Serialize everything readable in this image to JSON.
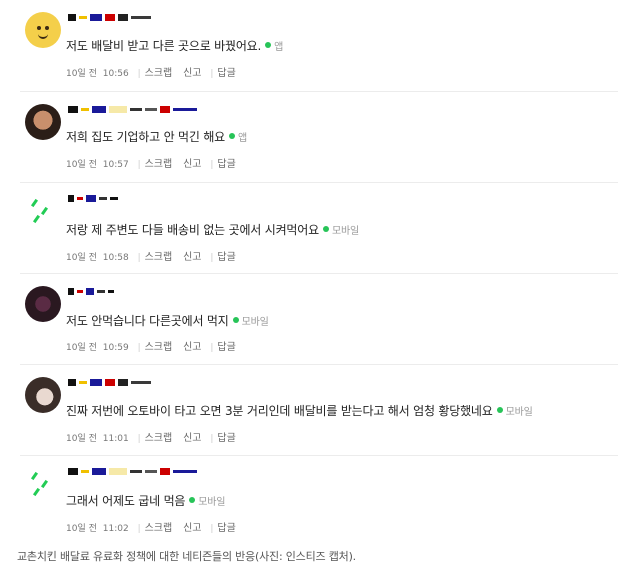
{
  "comments": [
    {
      "text": "저도 배달비 받고 다른 곳으로 바꿨어요.",
      "device": "앱",
      "date": "10일 전",
      "time": "10:56"
    },
    {
      "text": "저희 집도 기업하고 안 먹긴 해요",
      "device": "앱",
      "date": "10일 전",
      "time": "10:57"
    },
    {
      "text": "저랑 제 주변도 다들 배송비 없는 곳에서 시켜먹어요",
      "device": "모바일",
      "date": "10일 전",
      "time": "10:58"
    },
    {
      "text": "저도 안먹습니다 다른곳에서 먹지",
      "device": "모바일",
      "date": "10일 전",
      "time": "10:59"
    },
    {
      "text": "진짜 저번에 오토바이 타고 오면 3분 거리인데 배달비를 받는다고 해서 엄청 황당했네요",
      "device": "모바일",
      "date": "10일 전",
      "time": "11:01"
    },
    {
      "text": "그래서 어제도 굽네 먹음",
      "device": "모바일",
      "date": "10일 전",
      "time": "11:02"
    }
  ],
  "actions": {
    "scrap": "스크랩",
    "report": "신고",
    "reply": "답글"
  },
  "caption": "교촌치킨 배달료 유료화 정책에 대한 네티즌들의 반응(사진: 인스티즈 캡처).",
  "colors": {
    "accent": "#27c458",
    "text": "#222222",
    "muted": "#777777"
  }
}
